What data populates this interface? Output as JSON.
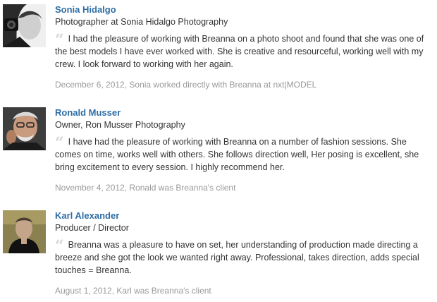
{
  "recommendations": [
    {
      "name": "Sonia Hidalgo",
      "headline": "Photographer at Sonia Hidalgo Photography",
      "quote_icon": "quote-icon",
      "quote": "I had the pleasure of working with Breanna on a photo shoot and found that she was one of the best models I have ever worked with. She is creative and resourceful, working well with my crew. I look forward to working with her again.",
      "meta": "December 6, 2012, Sonia worked directly with Breanna at nxt|MODEL"
    },
    {
      "name": "Ronald Musser",
      "headline": "Owner, Ron Musser Photography",
      "quote_icon": "quote-icon",
      "quote": "I have had the pleasure of working with Breanna on a number of fashion sessions. She comes on time, works well with others. She follows direction well, Her posing is excellent, she bring excitement to every session. I highly recommend her.",
      "meta": "November 4, 2012, Ronald was Breanna's client"
    },
    {
      "name": "Karl Alexander",
      "headline": "Producer / Director",
      "quote_icon": "quote-icon",
      "quote": "Breanna was a pleasure to have on set, her understanding of production made directing a breeze and she got the look we wanted right away. Professional, takes direction, adds special touches = Breanna.",
      "meta": "August 1, 2012, Karl was Breanna's client"
    }
  ]
}
